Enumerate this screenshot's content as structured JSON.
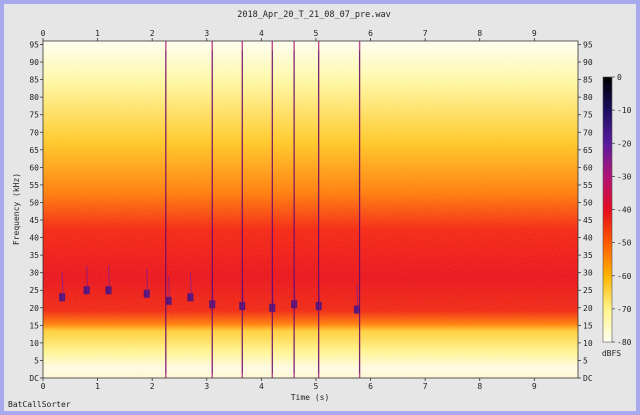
{
  "app": {
    "brand": "BatCallSorter"
  },
  "chart_data": {
    "type": "heatmap",
    "title": "2018_Apr_20_T_21_08_07_pre.wav",
    "xlabel": "Time (s)",
    "ylabel": "Frequency (kHz)",
    "xlim": [
      0,
      9.8
    ],
    "ylim": [
      0,
      96
    ],
    "x_ticks": [
      "0",
      "1",
      "2",
      "3",
      "4",
      "5",
      "6",
      "7",
      "8",
      "9"
    ],
    "y_ticks": [
      "DC",
      "5",
      "10",
      "15",
      "20",
      "25",
      "30",
      "35",
      "40",
      "45",
      "50",
      "55",
      "60",
      "65",
      "70",
      "75",
      "80",
      "85",
      "90",
      "95"
    ],
    "colorbar": {
      "label": "dBFS",
      "range": [
        -80,
        0
      ],
      "ticks": [
        "0",
        "-10",
        "-20",
        "-30",
        "-40",
        "-50",
        "-60",
        "-70",
        "-80"
      ],
      "colors": [
        "#000000",
        "#1c0e5e",
        "#5a1a9e",
        "#b01478",
        "#e60a20",
        "#ff5a00",
        "#ffb400",
        "#fff48a",
        "#fffff0"
      ]
    },
    "noise_band_khz": [
      11,
      45
    ],
    "clicks_s": [
      2.25,
      3.1,
      3.65,
      4.2,
      4.6,
      5.05,
      5.8
    ],
    "calls": [
      {
        "t": 0.35,
        "f": 23
      },
      {
        "t": 0.8,
        "f": 25
      },
      {
        "t": 1.2,
        "f": 25
      },
      {
        "t": 1.9,
        "f": 24
      },
      {
        "t": 2.3,
        "f": 22
      },
      {
        "t": 2.7,
        "f": 23
      },
      {
        "t": 3.1,
        "f": 21
      },
      {
        "t": 3.65,
        "f": 20.5
      },
      {
        "t": 4.2,
        "f": 20
      },
      {
        "t": 4.6,
        "f": 21
      },
      {
        "t": 5.05,
        "f": 20.5
      },
      {
        "t": 5.75,
        "f": 19.5
      }
    ]
  }
}
